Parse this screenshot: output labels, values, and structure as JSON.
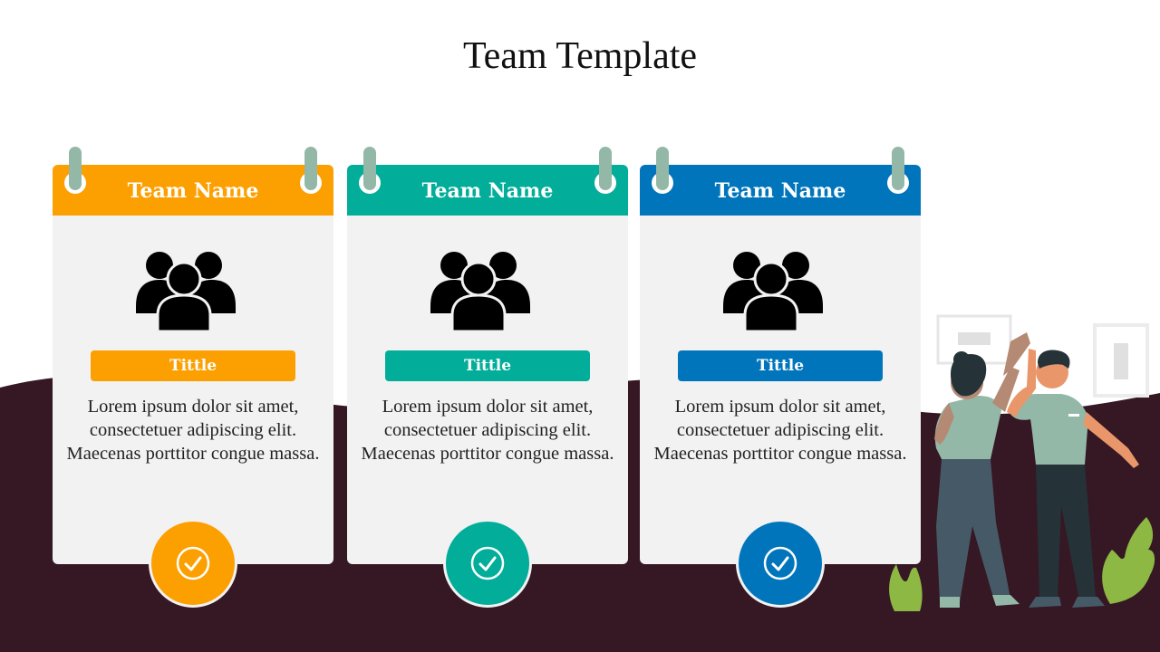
{
  "slide": {
    "title": "Team Template",
    "background_color": "#ffffff",
    "wave_color": "#361724"
  },
  "cards": [
    {
      "team_name": "Team Name",
      "role_label": "Tittle",
      "description": "Lorem ipsum dolor sit amet, consectetuer adipiscing elit. Maecenas porttitor congue massa.",
      "accent_color": "#fca002",
      "icon": "people-group-icon",
      "badge_icon": "check-circle-icon"
    },
    {
      "team_name": "Team Name",
      "role_label": "Tittle",
      "description": "Lorem ipsum dolor sit amet, consectetuer adipiscing elit. Maecenas porttitor congue massa.",
      "accent_color": "#02ad99",
      "icon": "people-group-icon",
      "badge_icon": "check-circle-icon"
    },
    {
      "team_name": "Team Name",
      "role_label": "Tittle",
      "description": "Lorem ipsum dolor sit amet, consectetuer adipiscing elit. Maecenas porttitor congue massa.",
      "accent_color": "#0175bc",
      "icon": "people-group-icon",
      "badge_icon": "check-circle-icon"
    }
  ],
  "illustration": {
    "subject": "two-people-high-five-illustration",
    "ring_color": "#94b8a8"
  }
}
